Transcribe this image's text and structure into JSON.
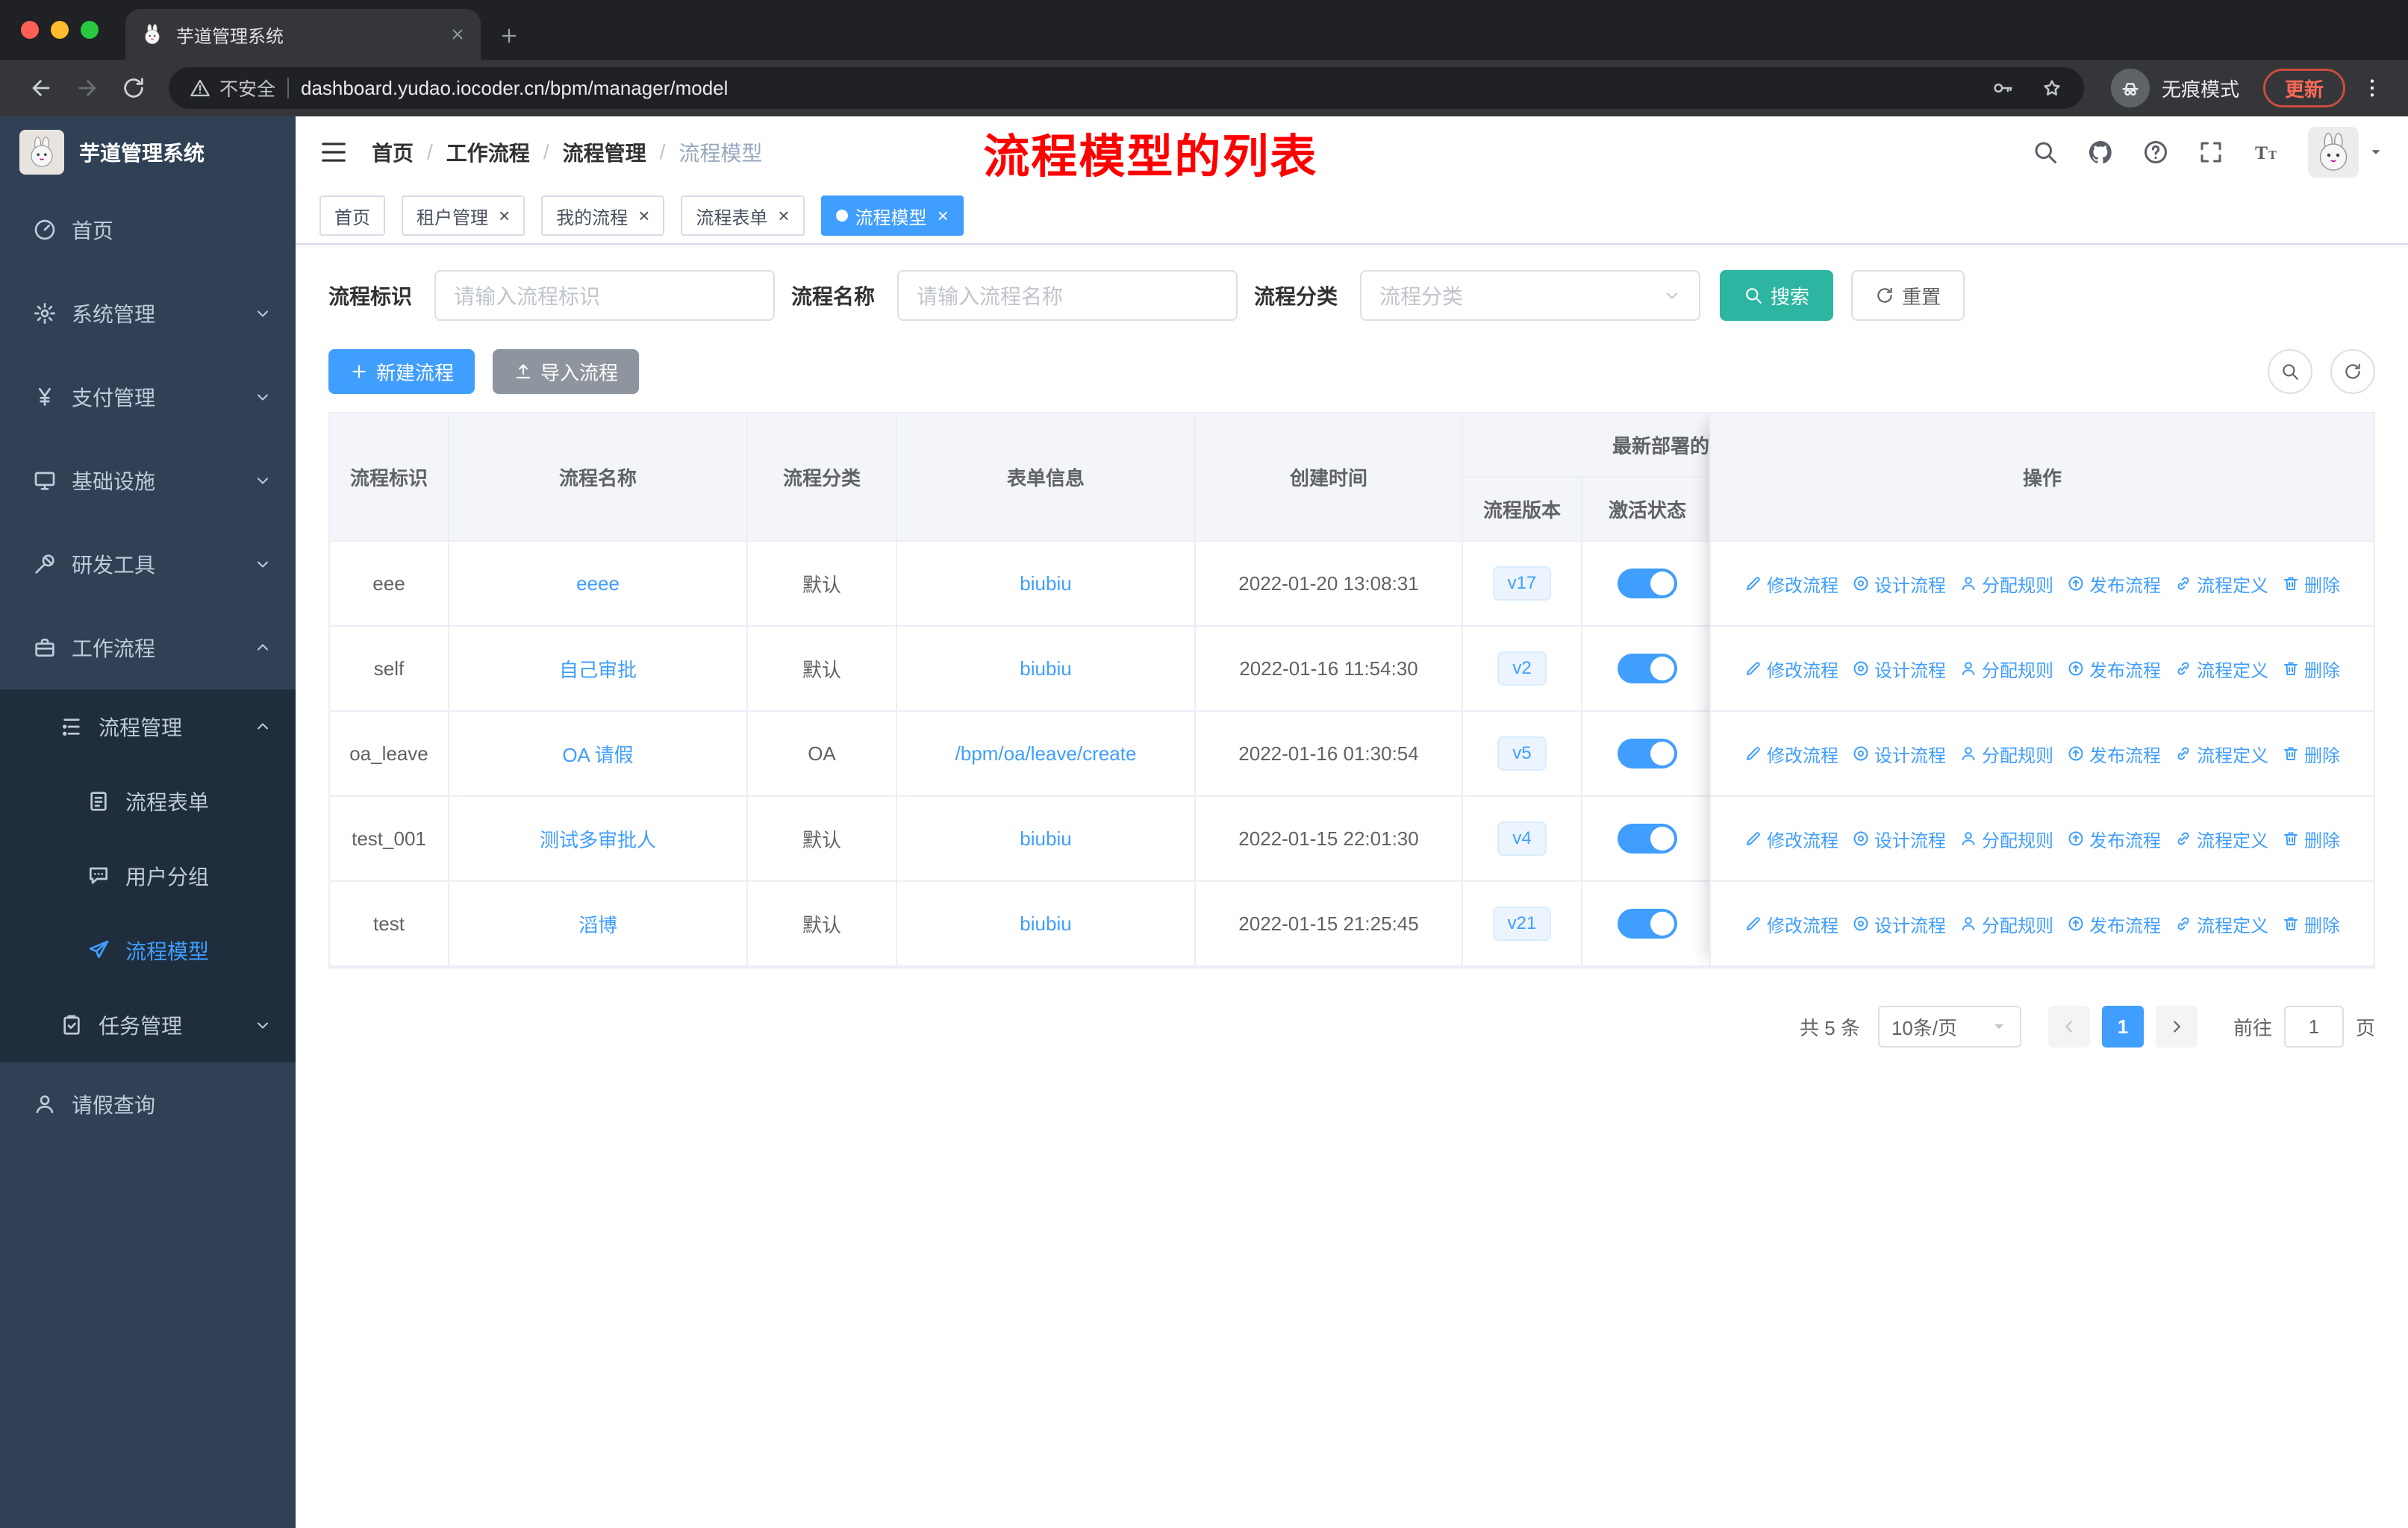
{
  "browser": {
    "tab_title": "芋道管理系统",
    "security_label": "不安全",
    "url": "dashboard.yudao.iocoder.cn/bpm/manager/model",
    "incognito_label": "无痕模式",
    "update_label": "更新"
  },
  "sidebar": {
    "logo_title": "芋道管理系统",
    "items": [
      {
        "id": "home",
        "label": "首页",
        "icon": "dashboard-icon",
        "level": 1
      },
      {
        "id": "system",
        "label": "系统管理",
        "icon": "gear-icon",
        "level": 1,
        "chevron": "down"
      },
      {
        "id": "payment",
        "label": "支付管理",
        "icon": "yen-icon",
        "level": 1,
        "chevron": "down"
      },
      {
        "id": "infrastructure",
        "label": "基础设施",
        "icon": "monitor-icon",
        "level": 1,
        "chevron": "down"
      },
      {
        "id": "devtools",
        "label": "研发工具",
        "icon": "tools-icon",
        "level": 1,
        "chevron": "down"
      },
      {
        "id": "workflow",
        "label": "工作流程",
        "icon": "briefcase-icon",
        "level": 1,
        "chevron": "up"
      },
      {
        "id": "process-management",
        "label": "流程管理",
        "icon": "tree-icon",
        "level": 2,
        "sub": true,
        "chevron": "up"
      },
      {
        "id": "process-form",
        "label": "流程表单",
        "icon": "form-icon",
        "level": 3,
        "sub": true
      },
      {
        "id": "user-group",
        "label": "用户分组",
        "icon": "chat-group-icon",
        "level": 3,
        "sub": true
      },
      {
        "id": "process-model",
        "label": "流程模型",
        "icon": "send-icon",
        "level": 3,
        "sub": true,
        "active": true
      },
      {
        "id": "task-management",
        "label": "任务管理",
        "icon": "task-icon",
        "level": 2,
        "sub": true,
        "chevron": "down"
      },
      {
        "id": "leave-query",
        "label": "请假查询",
        "icon": "user-icon",
        "level": 1
      }
    ]
  },
  "header": {
    "breadcrumb": [
      "首页",
      "工作流程",
      "流程管理",
      "流程模型"
    ],
    "annotation": "流程模型的列表"
  },
  "tags": [
    {
      "id": "home",
      "label": "首页"
    },
    {
      "id": "tenant",
      "label": "租户管理",
      "closable": true
    },
    {
      "id": "my-process",
      "label": "我的流程",
      "closable": true
    },
    {
      "id": "process-form",
      "label": "流程表单",
      "closable": true
    },
    {
      "id": "process-model",
      "label": "流程模型",
      "closable": true,
      "active": true
    }
  ],
  "filters": {
    "fields": [
      {
        "id": "process-key",
        "label": "流程标识",
        "placeholder": "请输入流程标识",
        "type": "input"
      },
      {
        "id": "process-name",
        "label": "流程名称",
        "placeholder": "请输入流程名称",
        "type": "input"
      },
      {
        "id": "process-category",
        "label": "流程分类",
        "placeholder": "流程分类",
        "type": "select"
      }
    ],
    "search_label": "搜索",
    "reset_label": "重置"
  },
  "toolbar": {
    "create_label": "新建流程",
    "import_label": "导入流程"
  },
  "table": {
    "columns": [
      "流程标识",
      "流程名称",
      "流程分类",
      "表单信息",
      "创建时间"
    ],
    "group_header": "最新部署的",
    "sub_columns": [
      "流程版本",
      "激活状态"
    ],
    "actions_header": "操作",
    "rows": [
      {
        "key": "eee",
        "name": "eeee",
        "category": "默认",
        "form": "biubiu",
        "created": "2022-01-20 13:08:31",
        "version": "v17",
        "active": true
      },
      {
        "key": "self",
        "name": "自己审批",
        "category": "默认",
        "form": "biubiu",
        "created": "2022-01-16 11:54:30",
        "version": "v2",
        "active": true
      },
      {
        "key": "oa_leave",
        "name": "OA 请假",
        "category": "OA",
        "form": "/bpm/oa/leave/create",
        "created": "2022-01-16 01:30:54",
        "version": "v5",
        "active": true
      },
      {
        "key": "test_001",
        "name": "测试多审批人",
        "category": "默认",
        "form": "biubiu",
        "created": "2022-01-15 22:01:30",
        "version": "v4",
        "active": true
      },
      {
        "key": "test",
        "name": "滔博",
        "category": "默认",
        "form": "biubiu",
        "created": "2022-01-15 21:25:45",
        "version": "v21",
        "active": true
      }
    ],
    "row_actions": [
      {
        "id": "edit",
        "label": "修改流程",
        "icon": "edit-icon"
      },
      {
        "id": "design",
        "label": "设计流程",
        "icon": "design-icon"
      },
      {
        "id": "assign",
        "label": "分配规则",
        "icon": "assign-icon"
      },
      {
        "id": "publish",
        "label": "发布流程",
        "icon": "publish-icon"
      },
      {
        "id": "definition",
        "label": "流程定义",
        "icon": "definition-icon"
      },
      {
        "id": "delete",
        "label": "删除",
        "icon": "delete-icon"
      }
    ]
  },
  "pagination": {
    "total_label": "共 5 条",
    "page_size": "10条/页",
    "current_page": "1",
    "goto_label": "前往",
    "goto_value": "1",
    "page_label": "页"
  },
  "colors": {
    "accent": "#409eff",
    "search_button": "#2cb6a2",
    "annotation": "#ff0000",
    "toggle_on": "#409eff",
    "sidebar_bg": "#304156",
    "submenu_bg": "#1f2d3d",
    "tag_active": "#409eff"
  }
}
